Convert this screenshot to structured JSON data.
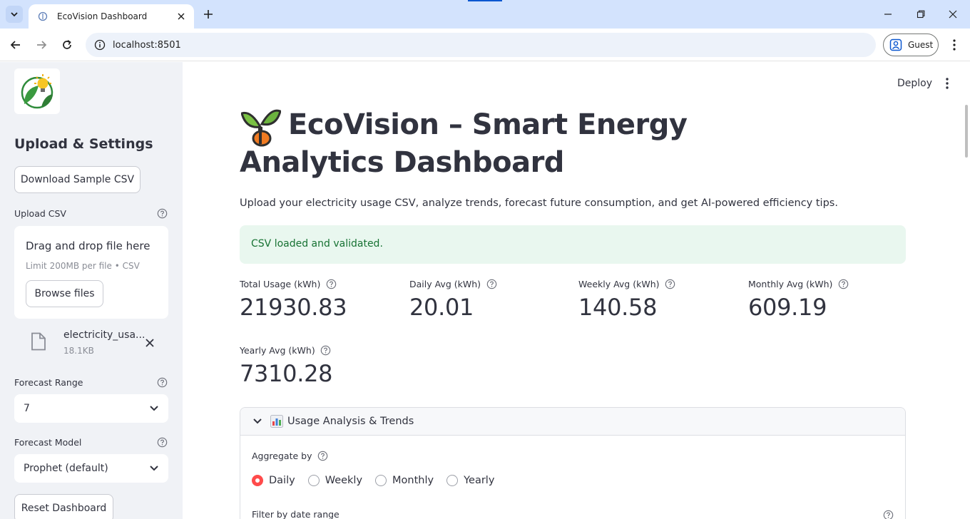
{
  "browser": {
    "tab_title": "EcoVision Dashboard",
    "url": "localhost:8501",
    "profile_label": "Guest"
  },
  "sidebar": {
    "heading": "Upload & Settings",
    "download_button": "Download Sample CSV",
    "upload_label": "Upload CSV",
    "dropzone_title": "Drag and drop file here",
    "dropzone_limit": "Limit 200MB per file • CSV",
    "browse_button": "Browse files",
    "uploaded_file_name": "electricity_usa...",
    "uploaded_file_size": "18.1KB",
    "forecast_range_label": "Forecast Range",
    "forecast_range_value": "7",
    "forecast_model_label": "Forecast Model",
    "forecast_model_value": "Prophet (default)",
    "reset_button": "Reset Dashboard"
  },
  "header": {
    "deploy_label": "Deploy"
  },
  "main": {
    "title": "EcoVision – Smart Energy Analytics Dashboard",
    "subtitle": "Upload your electricity usage CSV, analyze trends, forecast future consumption, and get AI-powered efficiency tips.",
    "alert": "CSV loaded and validated.",
    "metrics": [
      {
        "label": "Total Usage (kWh)",
        "value": "21930.83"
      },
      {
        "label": "Daily Avg (kWh)",
        "value": "20.01"
      },
      {
        "label": "Weekly Avg (kWh)",
        "value": "140.58"
      },
      {
        "label": "Monthly Avg (kWh)",
        "value": "609.19"
      },
      {
        "label": "Yearly Avg (kWh)",
        "value": "7310.28"
      }
    ],
    "expander": {
      "title": "Usage Analysis & Trends",
      "aggregate_label": "Aggregate by",
      "options": [
        "Daily",
        "Weekly",
        "Monthly",
        "Yearly"
      ],
      "selected": "Daily",
      "filter_label": "Filter by date range"
    }
  },
  "colors": {
    "accent": "#ff4b4b",
    "success_bg": "#e9f7ef",
    "success_text": "#177233",
    "sidebar_bg": "#f0f2f6",
    "tabbar_bg": "#d3e3fd"
  }
}
